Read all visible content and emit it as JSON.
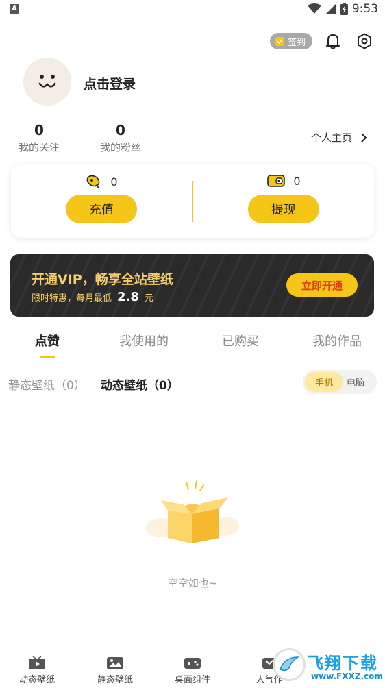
{
  "status_bar": {
    "time": "9:53",
    "left_badge": "A"
  },
  "top_actions": {
    "signin_label": "签到"
  },
  "profile": {
    "login_label": "点击登录"
  },
  "stats": {
    "following_count": "0",
    "following_label": "我的关注",
    "followers_count": "0",
    "followers_label": "我的粉丝",
    "homepage_label": "个人主页"
  },
  "wallet": {
    "coins_count": "0",
    "recharge_label": "充值",
    "balance_count": "0",
    "withdraw_label": "提现"
  },
  "vip": {
    "title": "开通VIP，畅享全站壁纸",
    "sub_prefix": "限时特惠，每月最低",
    "price": "2.8",
    "unit": "元",
    "button": "立即开通"
  },
  "tabs": [
    "点赞",
    "我使用的",
    "已购买",
    "我的作品"
  ],
  "sub_filters": {
    "static": "静态壁纸（0）",
    "dynamic": "动态壁纸（0）"
  },
  "device_toggle": {
    "phone": "手机",
    "pc": "电脑"
  },
  "empty": {
    "text": "空空如也~"
  },
  "bottom_nav": [
    "动态壁纸",
    "静态壁纸",
    "桌面组件",
    "人气作"
  ],
  "watermark": {
    "title": "飞翔下载",
    "url": "www.FXXZ.com"
  },
  "colors": {
    "accent": "#f5c518",
    "vip_gold": "#f6cf6b",
    "vip_red": "#e03a1f"
  }
}
